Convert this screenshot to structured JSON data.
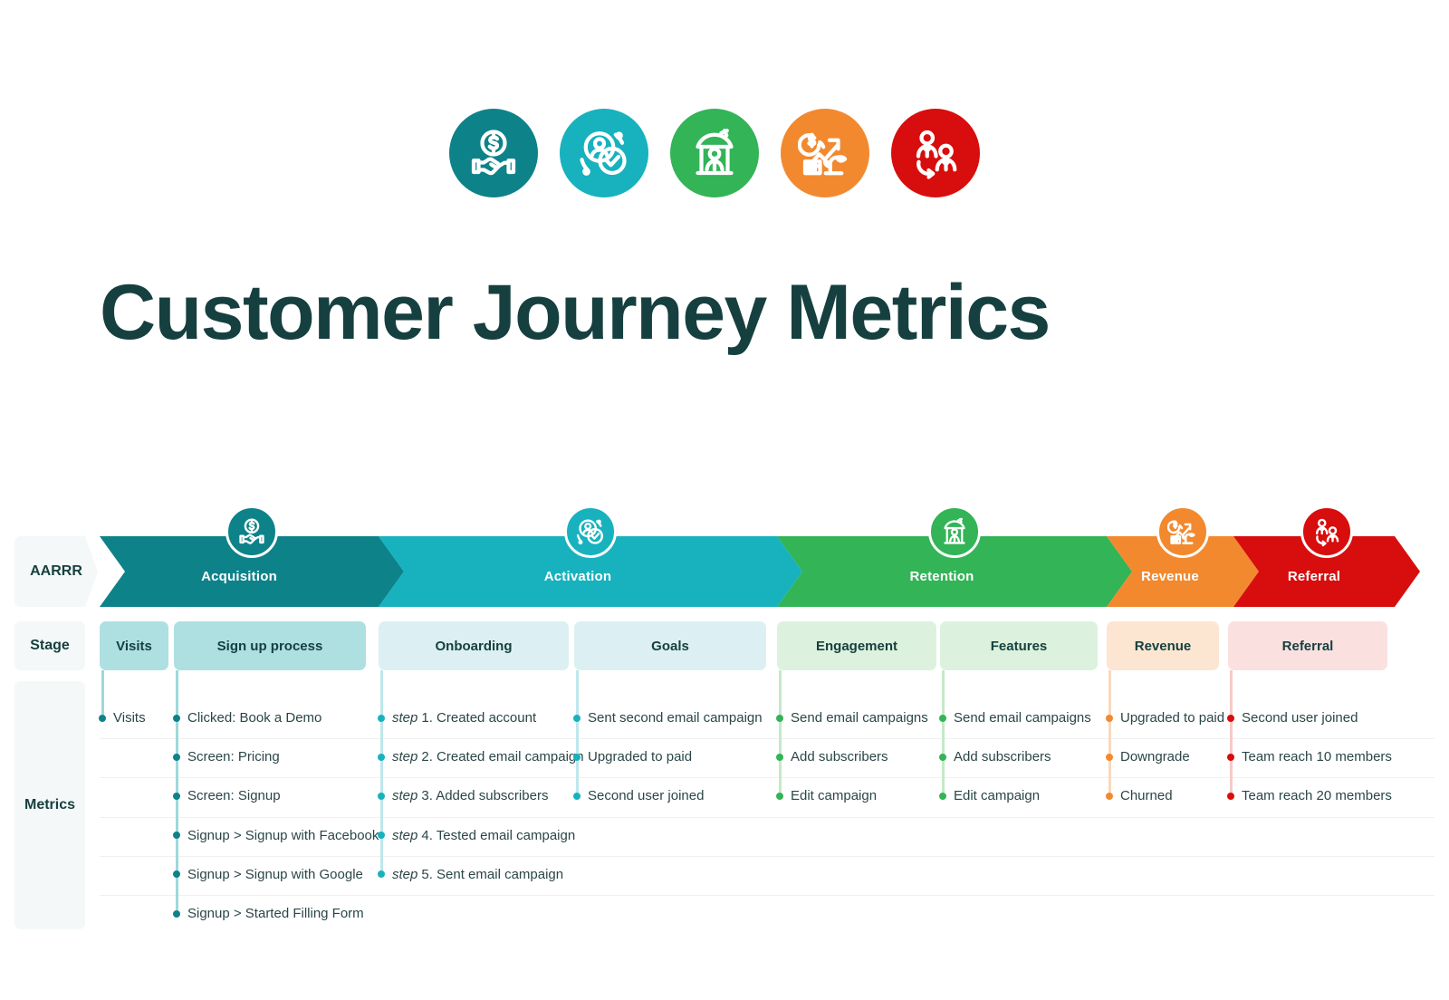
{
  "title": "Customer Journey Metrics",
  "row_labels": {
    "aarrr": "AARRR",
    "stage": "Stage",
    "metrics": "Metrics"
  },
  "colors": {
    "acquisition": "#0E8289",
    "activation": "#17B2BE",
    "retention": "#32B457",
    "revenue": "#F2892F",
    "referral": "#D80D0D",
    "title": "#16403F",
    "label_chip_bg": "#F4F8F8",
    "row_line": "#EDF1F1"
  },
  "top_icons": [
    {
      "name": "handshake-money-icon",
      "color": "#0E8289"
    },
    {
      "name": "user-check-icon",
      "color": "#17B2BE"
    },
    {
      "name": "umbrella-user-icon",
      "color": "#32B457"
    },
    {
      "name": "growth-chart-icon",
      "color": "#F2892F"
    },
    {
      "name": "referral-users-icon",
      "color": "#D80D0D"
    }
  ],
  "aarrr": [
    {
      "label": "Acquisition",
      "color": "#0E8289",
      "icon": "handshake-money-icon"
    },
    {
      "label": "Activation",
      "color": "#17B2BE",
      "icon": "user-check-icon"
    },
    {
      "label": "Retention",
      "color": "#32B457",
      "icon": "umbrella-user-icon"
    },
    {
      "label": "Revenue",
      "color": "#F2892F",
      "icon": "growth-chart-icon"
    },
    {
      "label": "Referral",
      "color": "#D80D0D",
      "icon": "referral-users-icon"
    }
  ],
  "stages": [
    {
      "label": "Visits",
      "bg": "#AEE0E1",
      "line": "#9ED8DA",
      "dot": "#0E8289"
    },
    {
      "label": "Sign up process",
      "bg": "#AEE0E1",
      "line": "#9ED8DA",
      "dot": "#0E8289"
    },
    {
      "label": "Onboarding",
      "bg": "#DCF0F3",
      "line": "#BEE7EC",
      "dot": "#17B2BE"
    },
    {
      "label": "Goals",
      "bg": "#DCF0F3",
      "line": "#BEE7EC",
      "dot": "#17B2BE"
    },
    {
      "label": "Engagement",
      "bg": "#DCF2DE",
      "line": "#C4E9C9",
      "dot": "#32B457"
    },
    {
      "label": "Features",
      "bg": "#DCF2DE",
      "line": "#C4E9C9",
      "dot": "#32B457"
    },
    {
      "label": "Revenue",
      "bg": "#FCE6D2",
      "line": "#FAD9BE",
      "dot": "#F2892F"
    },
    {
      "label": "Referral",
      "bg": "#FBE0E0",
      "line": "#F7C9C9",
      "dot": "#D80D0D"
    }
  ],
  "metrics_columns": [
    {
      "stage": "Visits",
      "items": [
        {
          "prefix": "",
          "text": "Visits"
        }
      ]
    },
    {
      "stage": "Sign up process",
      "items": [
        {
          "prefix": "",
          "text": "Clicked: Book a Demo"
        },
        {
          "prefix": "",
          "text": "Screen: Pricing"
        },
        {
          "prefix": "",
          "text": "Screen: Signup"
        },
        {
          "prefix": "",
          "text": "Signup > Signup with Facebook"
        },
        {
          "prefix": "",
          "text": "Signup > Signup with Google"
        },
        {
          "prefix": "",
          "text": "Signup > Started Filling Form"
        }
      ]
    },
    {
      "stage": "Onboarding",
      "items": [
        {
          "prefix": "step",
          "text": "1. Created account"
        },
        {
          "prefix": "step",
          "text": "2. Created email campaign"
        },
        {
          "prefix": "step",
          "text": "3. Added subscribers"
        },
        {
          "prefix": "step",
          "text": "4. Tested email campaign"
        },
        {
          "prefix": "step",
          "text": "5. Sent email campaign"
        }
      ]
    },
    {
      "stage": "Goals",
      "items": [
        {
          "prefix": "",
          "text": "Sent second email campaign"
        },
        {
          "prefix": "",
          "text": "Upgraded to paid"
        },
        {
          "prefix": "",
          "text": "Second user joined"
        }
      ]
    },
    {
      "stage": "Engagement",
      "items": [
        {
          "prefix": "",
          "text": "Send email campaigns"
        },
        {
          "prefix": "",
          "text": "Add subscribers"
        },
        {
          "prefix": "",
          "text": "Edit campaign"
        }
      ]
    },
    {
      "stage": "Features",
      "items": [
        {
          "prefix": "",
          "text": "Send email campaigns"
        },
        {
          "prefix": "",
          "text": "Add subscribers"
        },
        {
          "prefix": "",
          "text": "Edit campaign"
        }
      ]
    },
    {
      "stage": "Revenue",
      "items": [
        {
          "prefix": "",
          "text": "Upgraded to paid"
        },
        {
          "prefix": "",
          "text": "Downgrade"
        },
        {
          "prefix": "",
          "text": "Churned"
        }
      ]
    },
    {
      "stage": "Referral",
      "items": [
        {
          "prefix": "",
          "text": "Second user joined"
        },
        {
          "prefix": "",
          "text": "Team reach 10 members"
        },
        {
          "prefix": "",
          "text": "Team reach 20 members"
        }
      ]
    }
  ]
}
